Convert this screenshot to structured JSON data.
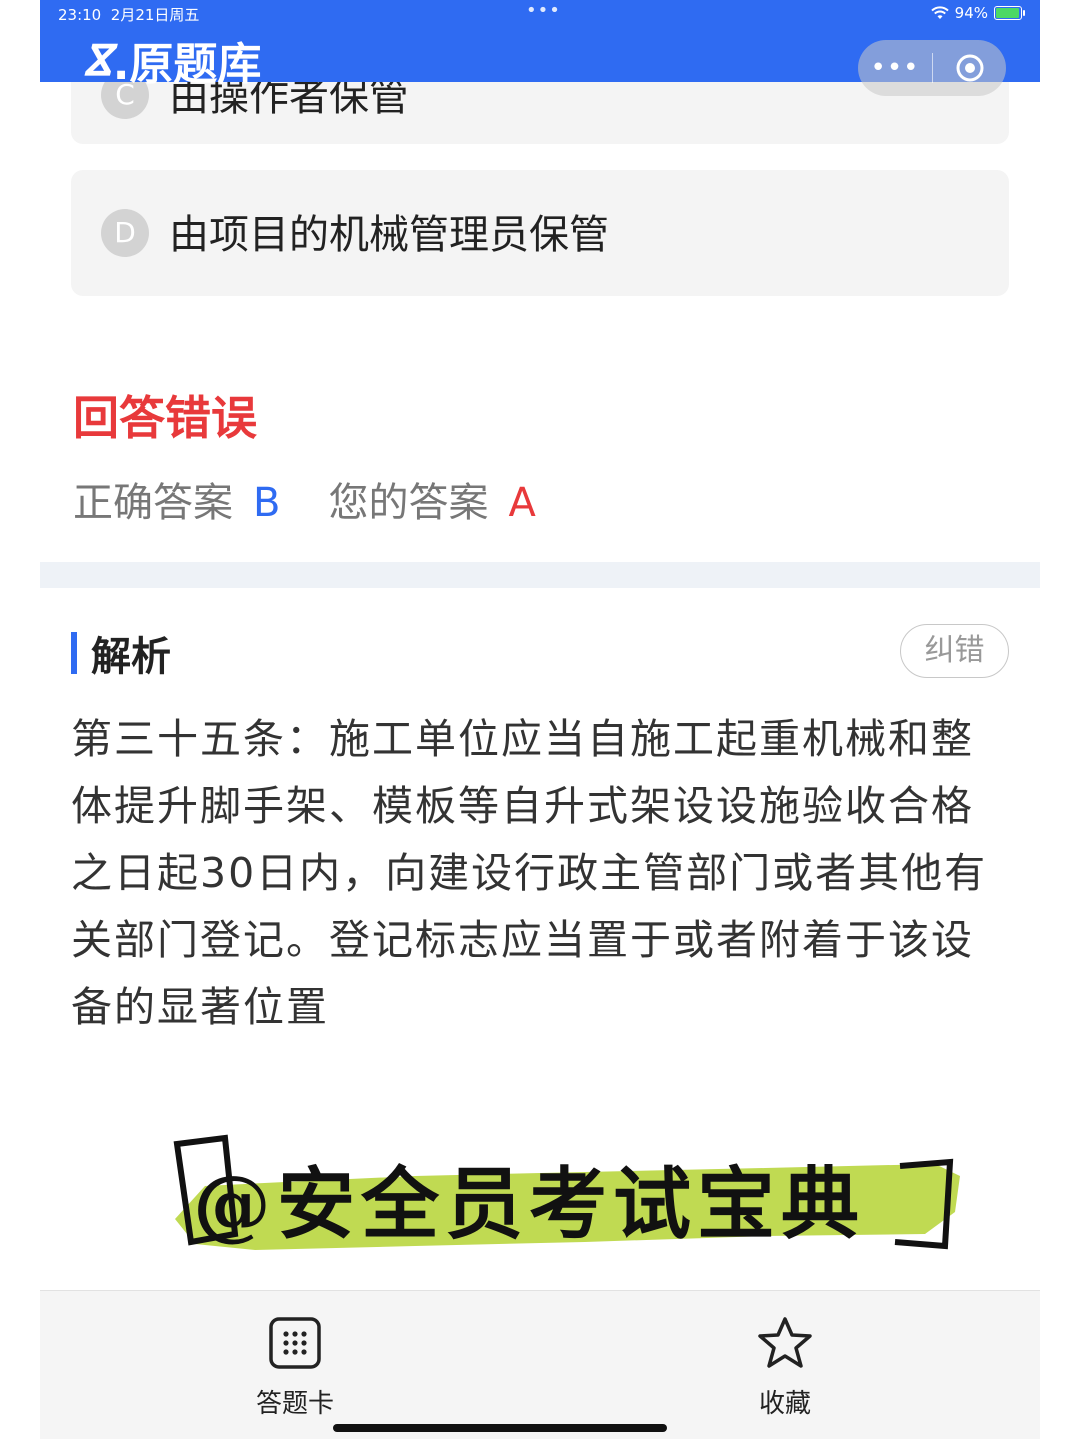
{
  "status_bar": {
    "time": "23:10",
    "date": "2月21日周五",
    "center_dots": "•••",
    "battery": "94%",
    "battery_level": 0.94
  },
  "header": {
    "logo_mark": "ⴵ",
    "app_name": ".原题库",
    "capsule_more": "•••"
  },
  "options": [
    {
      "letter": "C",
      "text": "由操作者保管"
    },
    {
      "letter": "D",
      "text": "由项目的机械管理员保管"
    }
  ],
  "result": {
    "title": "回答错误",
    "correct_label": "正确答案",
    "correct_value": "B",
    "your_label": "您的答案",
    "your_value": "A"
  },
  "analysis": {
    "title": "解析",
    "report_button": "纠错",
    "body": "第三十五条：施工单位应当自施工起重机械和整体提升脚手架、模板等自升式架设设施验收合格之日起30日内，向建设行政主管部门或者其他有关部门登记。登记标志应当置于或者附着于该设备的显著位置"
  },
  "watermark": {
    "text": "@安全员考试宝典"
  },
  "bottom_nav": [
    {
      "label": "答题卡",
      "icon": "answer-card-grid-icon"
    },
    {
      "label": "收藏",
      "icon": "star-outline-icon"
    }
  ],
  "colors": {
    "header_blue": "#2f6bf2",
    "error_red": "#e8393b",
    "highlight_green": "#b5d334"
  }
}
